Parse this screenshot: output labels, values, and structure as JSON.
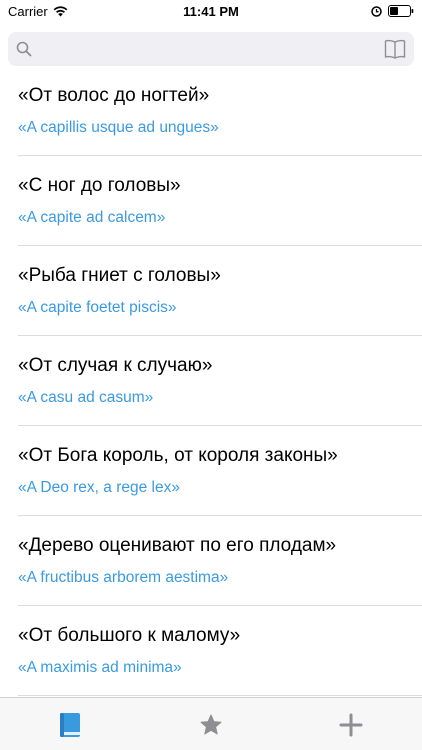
{
  "status_bar": {
    "carrier": "Carrier",
    "time": "11:41 PM"
  },
  "search": {
    "placeholder": "",
    "value": ""
  },
  "phrases": [
    {
      "ru": "«От волос до ногтей»",
      "la": "«A capillis usque ad ungues»"
    },
    {
      "ru": "«С ног до головы»",
      "la": "«A capite ad calcem»"
    },
    {
      "ru": "«Рыба гниет с головы»",
      "la": "«A capite foetet piscis»"
    },
    {
      "ru": "«От случая к случаю»",
      "la": "«A casu ad casum»"
    },
    {
      "ru": "«От Бога король, от короля законы»",
      "la": "«A Deo rex, a rege lex»"
    },
    {
      "ru": "«Дерево оценивают по его плодам»",
      "la": "«A fructibus arborem aestima»"
    },
    {
      "ru": "«От большого к малому»",
      "la": "«A maximis ad minima»"
    }
  ],
  "colors": {
    "accent": "#3a9ae0",
    "inactive": "#8e8e93"
  },
  "tabs": [
    {
      "icon": "book-icon",
      "selected": true
    },
    {
      "icon": "star-icon",
      "selected": false
    },
    {
      "icon": "plus-icon",
      "selected": false
    }
  ]
}
